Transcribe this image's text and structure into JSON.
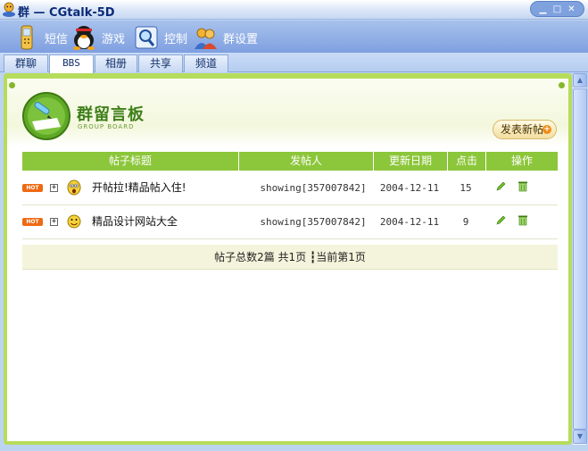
{
  "window": {
    "title": "群 — CGtalk-5D",
    "buttons": [
      "▁",
      "□",
      "✕"
    ]
  },
  "menu": [
    {
      "label": "短信",
      "icon": "phone-icon"
    },
    {
      "label": "游戏",
      "icon": "penguin-icon"
    },
    {
      "label": "控制",
      "icon": "magnifier-icon"
    },
    {
      "label": "群设置",
      "icon": "group-people-icon"
    }
  ],
  "tabs": [
    {
      "label": "群聊",
      "active": false
    },
    {
      "label": "BBS",
      "active": true
    },
    {
      "label": "相册",
      "active": false
    },
    {
      "label": "共享",
      "active": false
    },
    {
      "label": "频道",
      "active": false
    }
  ],
  "board": {
    "title": "群留言板",
    "subtitle": "GROUP BOARD",
    "new_post_label": "发表新帖",
    "plus": "+"
  },
  "table": {
    "headers": [
      "帖子标题",
      "发帖人",
      "更新日期",
      "点击",
      "操作"
    ],
    "rows": [
      {
        "hot": "HOT",
        "expand": "+",
        "emote": "surprised-face-icon",
        "title": "开帖拉!精品帖入住!",
        "poster": "showing[357007842]",
        "date": "2004-12-11",
        "hits": "15"
      },
      {
        "hot": "HOT",
        "expand": "+",
        "emote": "smiley-face-icon",
        "title": "精品设计网站大全",
        "poster": "showing[357007842]",
        "date": "2004-12-11",
        "hits": "9"
      }
    ]
  },
  "footer": {
    "text": "帖子总数2篇 共1页 ┇当前第1页"
  },
  "colors": {
    "accent_green": "#8cc63a",
    "frame_green": "#b6dc5c",
    "menu_blue": "#7f9fe0",
    "hot_orange": "#ee6a12"
  }
}
